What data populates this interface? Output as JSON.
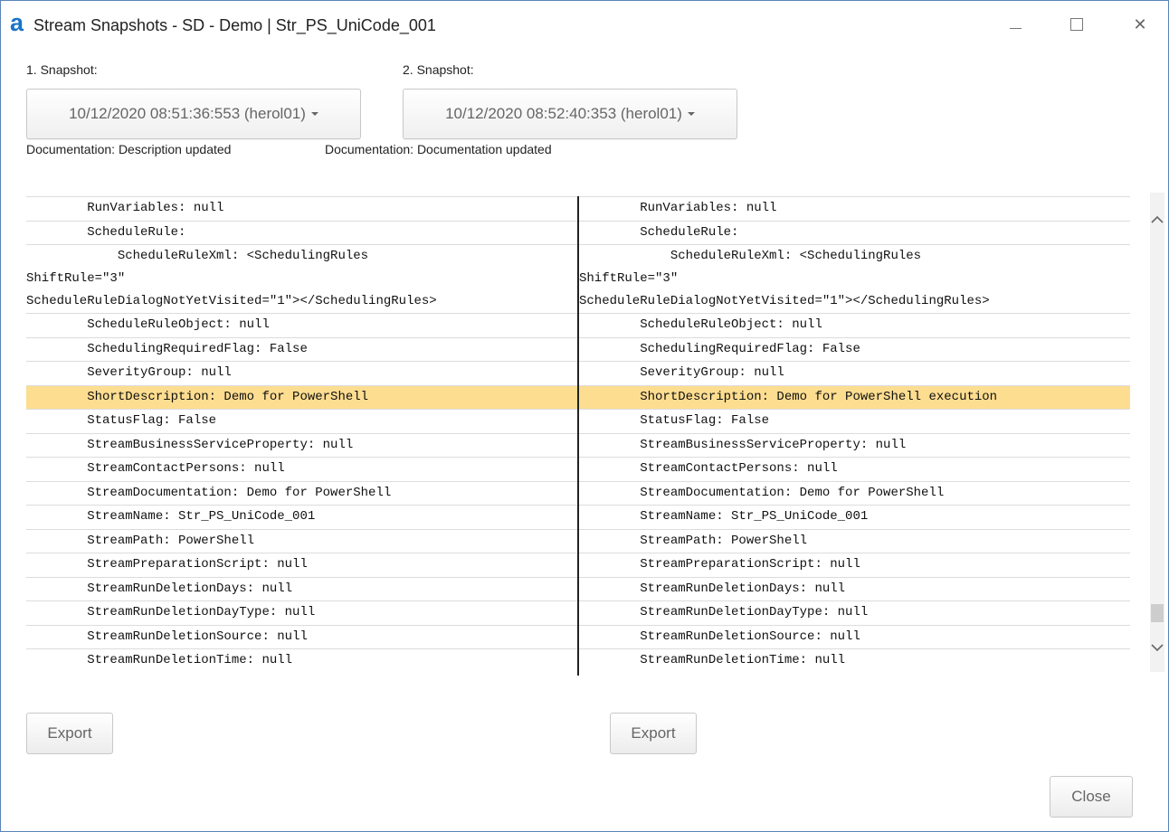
{
  "window": {
    "logo": "a",
    "title": "Stream Snapshots - SD - Demo | Str_PS_UniCode_001"
  },
  "snapshot1": {
    "label": "1. Snapshot:",
    "value": "10/12/2020 08:51:36:553 (herol01)",
    "documentation": "Documentation: Description updated"
  },
  "snapshot2": {
    "label": "2. Snapshot:",
    "value": "10/12/2020 08:52:40:353 (herol01)",
    "documentation": "Documentation: Documentation updated"
  },
  "left_rows": [
    "        RunVariables: null",
    "        ScheduleRule:",
    "            ScheduleRuleXml: <SchedulingRules\nShiftRule=\"3\"\nScheduleRuleDialogNotYetVisited=\"1\"></SchedulingRules>",
    "        ScheduleRuleObject: null",
    "        SchedulingRequiredFlag: False",
    "        SeverityGroup: null",
    "        ShortDescription: Demo for PowerShell",
    "        StatusFlag: False",
    "        StreamBusinessServiceProperty: null",
    "        StreamContactPersons: null",
    "        StreamDocumentation: Demo for PowerShell",
    "        StreamName: Str_PS_UniCode_001",
    "        StreamPath: PowerShell",
    "        StreamPreparationScript: null",
    "        StreamRunDeletionDays: null",
    "        StreamRunDeletionDayType: null",
    "        StreamRunDeletionSource: null",
    "        StreamRunDeletionTime: null"
  ],
  "right_rows": [
    "        RunVariables: null",
    "        ScheduleRule:",
    "            ScheduleRuleXml: <SchedulingRules\nShiftRule=\"3\"\nScheduleRuleDialogNotYetVisited=\"1\"></SchedulingRules>",
    "        ScheduleRuleObject: null",
    "        SchedulingRequiredFlag: False",
    "        SeverityGroup: null",
    "        ShortDescription: Demo for PowerShell execution",
    "        StatusFlag: False",
    "        StreamBusinessServiceProperty: null",
    "        StreamContactPersons: null",
    "        StreamDocumentation: Demo for PowerShell",
    "        StreamName: Str_PS_UniCode_001",
    "        StreamPath: PowerShell",
    "        StreamPreparationScript: null",
    "        StreamRunDeletionDays: null",
    "        StreamRunDeletionDayType: null",
    "        StreamRunDeletionSource: null",
    "        StreamRunDeletionTime: null"
  ],
  "highlighted_row_index": 6,
  "highlight_color": "#fddd90",
  "buttons": {
    "export_left": "Export",
    "export_right": "Export",
    "close": "Close"
  },
  "icons": {
    "minimize": "minimize-icon",
    "maximize": "maximize-icon",
    "close": "close-icon",
    "scroll_up": "chevron-up-icon",
    "scroll_down": "chevron-down-icon",
    "dropdown": "caret-down-icon"
  }
}
